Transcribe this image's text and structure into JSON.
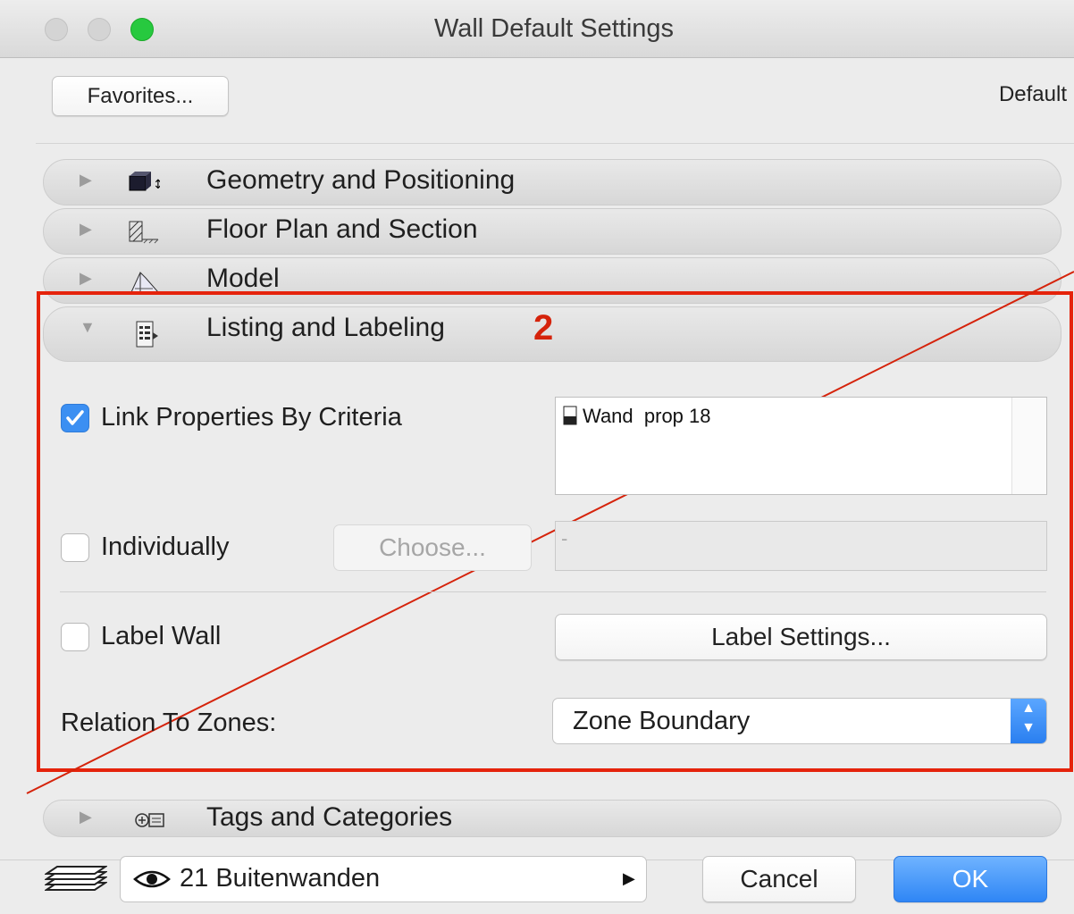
{
  "window": {
    "title": "Wall Default Settings"
  },
  "toolbar": {
    "favorites_label": "Favorites...",
    "default_label": "Default"
  },
  "panels": [
    {
      "label": "Geometry and Positioning",
      "icon": "geometry-icon",
      "expanded": false
    },
    {
      "label": "Floor Plan and Section",
      "icon": "hatch-icon",
      "expanded": false
    },
    {
      "label": "Model",
      "icon": "model-icon",
      "expanded": false
    },
    {
      "label": "Listing and Labeling",
      "icon": "listing-icon",
      "expanded": true
    },
    {
      "label": "Tags and Categories",
      "icon": "tags-icon",
      "expanded": false
    }
  ],
  "annotation": {
    "label": "2",
    "color": "#e5230b"
  },
  "listing": {
    "link_properties": {
      "label": "Link Properties By Criteria",
      "checked": true
    },
    "properties_list": [
      "Wand  prop 18"
    ],
    "individually": {
      "label": "Individually",
      "checked": false
    },
    "choose_label": "Choose...",
    "individual_value": "-",
    "label_wall": {
      "label": "Label Wall",
      "checked": false
    },
    "label_settings_label": "Label Settings...",
    "relation_label": "Relation To Zones:",
    "relation_value": "Zone Boundary"
  },
  "footer": {
    "layer_value": "21 Buitenwanden",
    "cancel_label": "Cancel",
    "ok_label": "OK"
  },
  "colors": {
    "accent": "#3b8ff2",
    "annotation_red": "#e5230b"
  }
}
